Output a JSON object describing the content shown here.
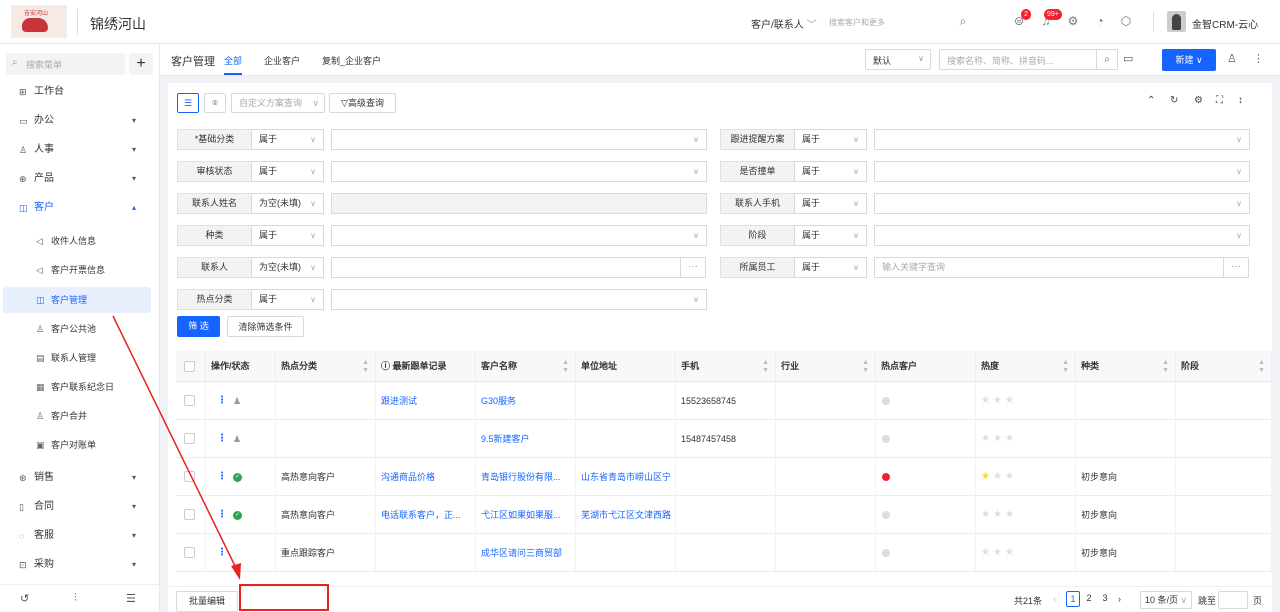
{
  "header": {
    "brand": "锦绣河山",
    "logo_text": "吉安河山",
    "global_select": "客户/联系人",
    "global_search_placeholder": "搜索客户和更多",
    "badge_todo": "2",
    "badge_notify": "99+",
    "user_name": "金智CRM-云心"
  },
  "sidebar": {
    "search_placeholder": "搜索菜单",
    "items": [
      {
        "label": "工作台"
      },
      {
        "label": "办公"
      },
      {
        "label": "人事"
      },
      {
        "label": "产品"
      },
      {
        "label": "客户"
      }
    ],
    "sub_items": [
      {
        "label": "收件人信息"
      },
      {
        "label": "客户开票信息"
      },
      {
        "label": "客户管理"
      },
      {
        "label": "客户公共池"
      },
      {
        "label": "联系人管理"
      },
      {
        "label": "客户联系纪念日"
      },
      {
        "label": "客户合并"
      },
      {
        "label": "客户对账单"
      }
    ],
    "items_after": [
      {
        "label": "销售"
      },
      {
        "label": "合同"
      },
      {
        "label": "客服"
      },
      {
        "label": "采购"
      }
    ]
  },
  "page": {
    "title": "客户管理",
    "tabs": [
      {
        "label": "全部"
      },
      {
        "label": "企业客户"
      },
      {
        "label": "复制_企业客户"
      }
    ],
    "view_select": "默认",
    "keyword_placeholder": "搜索名称、简称、拼音码...",
    "new_button": "新建"
  },
  "toolbar": {
    "custom_query_placeholder": "自定义方案查询",
    "advanced_query": "高级查询"
  },
  "filters": [
    {
      "label": "*基础分类",
      "op": "属于",
      "value": ""
    },
    {
      "label": "跟进提醒方案",
      "op": "属于",
      "value": ""
    },
    {
      "label": "审核状态",
      "op": "属于",
      "value": ""
    },
    {
      "label": "是否撞单",
      "op": "属于",
      "value": ""
    },
    {
      "label": "联系人姓名",
      "op": "为空(未填)",
      "value": ""
    },
    {
      "label": "联系人手机",
      "op": "属于",
      "value": ""
    },
    {
      "label": "种类",
      "op": "属于",
      "value": ""
    },
    {
      "label": "阶段",
      "op": "属于",
      "value": ""
    },
    {
      "label": "联系人",
      "op": "为空(未填)",
      "value": ""
    },
    {
      "label": "所属员工",
      "op": "属于",
      "value": "输入关键字查询"
    },
    {
      "label": "热点分类",
      "op": "属于",
      "value": ""
    }
  ],
  "filter_buttons": {
    "apply": "筛 选",
    "clear": "清除筛选条件"
  },
  "table": {
    "columns": [
      "操作/状态",
      "热点分类",
      "ⓘ 最新跟单记录",
      "客户名称",
      "单位地址",
      "手机",
      "行业",
      "热点客户",
      "热度",
      "种类",
      "阶段"
    ],
    "rows": [
      {
        "status": "user",
        "hot_category": "",
        "latest_record": "跟进测试",
        "customer": "G30服务",
        "address": "",
        "phone": "15523658745",
        "industry": "",
        "hot": false,
        "stars": 0,
        "kind": "",
        "stage": ""
      },
      {
        "status": "user",
        "hot_category": "",
        "latest_record": "",
        "customer": "9.5新建客户",
        "address": "",
        "phone": "15487457458",
        "industry": "",
        "hot": false,
        "stars": 0,
        "kind": "",
        "stage": ""
      },
      {
        "status": "ok",
        "hot_category": "高热意向客户",
        "latest_record": "沟通商品价格",
        "customer": "青岛银行股份有限...",
        "address": "山东省青岛市崂山区宁",
        "phone": "",
        "industry": "",
        "hot": true,
        "stars": 1,
        "kind": "初步意向",
        "stage": ""
      },
      {
        "status": "ok",
        "hot_category": "高热意向客户",
        "latest_record": "电话联系客户，正...",
        "customer": "弋江区如果如果服...",
        "address": "芜湖市弋江区文津西路",
        "phone": "",
        "industry": "",
        "hot": false,
        "stars": 0,
        "kind": "初步意向",
        "stage": ""
      },
      {
        "status": "none",
        "hot_category": "重点跟踪客户",
        "latest_record": "",
        "customer": "成华区请问三商贸部",
        "address": "",
        "phone": "",
        "industry": "",
        "hot": false,
        "stars": 0,
        "kind": "初步意向",
        "stage": ""
      }
    ]
  },
  "footer": {
    "batch_edit": "批量编辑",
    "total": "共21条",
    "pages": [
      "1",
      "2",
      "3"
    ],
    "page_size": "10 条/页",
    "jump_label": "跳至",
    "page_unit": "页"
  },
  "colors": {
    "accent": "#1664ff",
    "annotation": "#e6231f"
  }
}
